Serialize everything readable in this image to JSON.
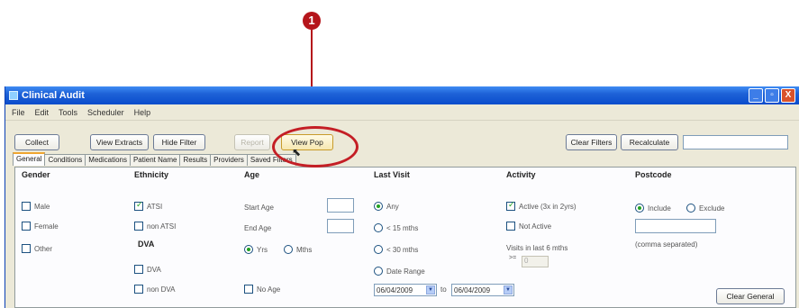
{
  "callout": {
    "number": "1"
  },
  "window": {
    "title": "Clinical Audit",
    "controls": {
      "minimize": "_",
      "maximize": "▫",
      "close": "X"
    }
  },
  "menu": [
    "File",
    "Edit",
    "Tools",
    "Scheduler",
    "Help"
  ],
  "toolbar": {
    "collect": "Collect",
    "view_extracts": "View Extracts",
    "hide_filter": "Hide Filter",
    "report": "Report",
    "view_pop": "View Pop",
    "clear_filters": "Clear Filters",
    "recalculate": "Recalculate"
  },
  "tabs": [
    "General",
    "Conditions",
    "Medications",
    "Patient Name",
    "Results",
    "Providers",
    "Saved Filters"
  ],
  "active_tab": "General",
  "general": {
    "gender": {
      "heading": "Gender",
      "options": [
        {
          "label": "Male",
          "checked": false
        },
        {
          "label": "Female",
          "checked": false
        },
        {
          "label": "Other",
          "checked": false
        }
      ]
    },
    "ethnicity": {
      "heading": "Ethnicity",
      "options": [
        {
          "label": "ATSI",
          "checked": true
        },
        {
          "label": "non ATSI",
          "checked": false
        }
      ]
    },
    "dva": {
      "heading": "DVA",
      "options": [
        {
          "label": "DVA",
          "checked": false
        },
        {
          "label": "non DVA",
          "checked": false
        }
      ]
    },
    "age": {
      "heading": "Age",
      "start_label": "Start Age",
      "end_label": "End Age",
      "units": [
        {
          "label": "Yrs",
          "checked": true
        },
        {
          "label": "Mths",
          "checked": false
        }
      ],
      "no_age": "No Age"
    },
    "last_visit": {
      "heading": "Last Visit",
      "options": [
        {
          "label": "Any",
          "checked": true
        },
        {
          "label": "< 15 mths",
          "checked": false
        },
        {
          "label": "< 30 mths",
          "checked": false
        },
        {
          "label": "Date Range",
          "checked": false
        }
      ],
      "date_from": "06/04/2009",
      "to_label": "to",
      "date_to": "06/04/2009"
    },
    "activity": {
      "heading": "Activity",
      "options": [
        {
          "label": "Active (3x in 2yrs)",
          "checked": true
        },
        {
          "label": "Not Active",
          "checked": false
        }
      ],
      "visits_label": "Visits in last 6 mths",
      "visits_op": ">=",
      "visits_value": "0"
    },
    "postcode": {
      "heading": "Postcode",
      "options": [
        {
          "label": "Include",
          "checked": true
        },
        {
          "label": "Exclude",
          "checked": false
        }
      ],
      "hint": "(comma separated)"
    },
    "clear_general": "Clear General"
  }
}
